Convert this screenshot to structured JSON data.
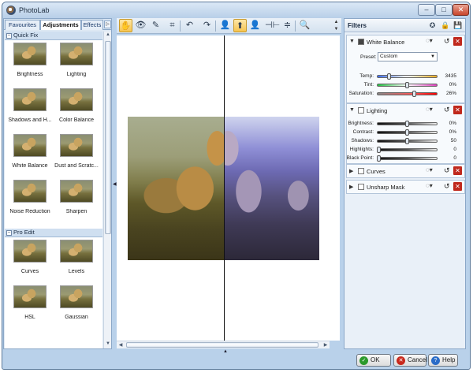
{
  "window": {
    "title": "PhotoLab",
    "min_label": "–",
    "max_label": "□",
    "close_label": "✕"
  },
  "left": {
    "tabs": [
      "Favourites",
      "Adjustments",
      "Effects"
    ],
    "tab_next": "▷",
    "sections": [
      {
        "title": "Quick Fix",
        "toggle": "–",
        "items": [
          "Brightness",
          "Lighting",
          "Shadows and H...",
          "Color Balance",
          "White Balance",
          "Dust and Scratc...",
          "Noise Reduction",
          "Sharpen"
        ]
      },
      {
        "title": "Pro Edit",
        "toggle": "–",
        "items": [
          "Curves",
          "Levels",
          "HSL",
          "Gaussian"
        ]
      }
    ]
  },
  "toolbar": {
    "icons": [
      "hand-icon",
      "eye-icon",
      "red-eye-icon",
      "crop-icon",
      "undo-icon",
      "redo-icon",
      "single-view-icon",
      "split-view-icon",
      "before-after-icon",
      "split-compare-icon",
      "compare-icon",
      "zoom-icon"
    ]
  },
  "filters": {
    "title": "Filters",
    "white_balance": {
      "name": "White Balance",
      "preset_label": "Preset:",
      "preset_value": "Custom",
      "params": [
        {
          "label": "Temp:",
          "value": "3435",
          "level": 0.18,
          "gradient": "linear-gradient(90deg,#3c6cff,#fff 50%,#ffb020)"
        },
        {
          "label": "Tint:",
          "value": "0%",
          "level": 0.5,
          "gradient": "linear-gradient(90deg,#20c040,#fff 50%,#e040c0)"
        },
        {
          "label": "Saturation:",
          "value": "26%",
          "level": 0.63,
          "gradient": "linear-gradient(90deg,#888,#f55 60%,#f00)"
        }
      ]
    },
    "lighting": {
      "name": "Lighting",
      "params": [
        {
          "label": "Brightness:",
          "value": "0%",
          "level": 0.5
        },
        {
          "label": "Contrast:",
          "value": "0%",
          "level": 0.5
        },
        {
          "label": "Shadows:",
          "value": "50",
          "level": 0.5
        },
        {
          "label": "Highlights:",
          "value": "0",
          "level": 0.0
        },
        {
          "label": "Black Point:",
          "value": "0",
          "level": 0.0
        }
      ]
    },
    "curves": {
      "name": "Curves"
    },
    "unsharp_mask": {
      "name": "Unsharp Mask"
    }
  },
  "buttons": {
    "ok": "OK",
    "cancel": "Cancel",
    "help": "Help"
  }
}
